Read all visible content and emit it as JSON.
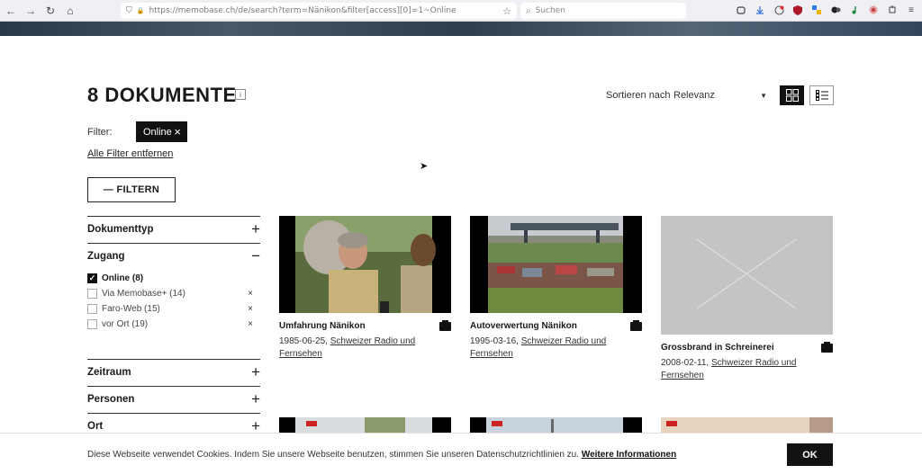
{
  "browser": {
    "url": "https://memobase.ch/de/search?term=Nänikon&filter[access][0]=1~Online",
    "search_placeholder": "Suchen"
  },
  "header": {
    "title": "8 DOKUMENTE",
    "info_icon": "i",
    "sort_label": "Sortieren nach",
    "sort_value": "Relevanz"
  },
  "filters": {
    "label": "Filter:",
    "active_chip": "Online",
    "remove_all": "Alle Filter entfernen",
    "toggle_button": "— FILTERN"
  },
  "sidebar": {
    "sections": [
      {
        "label": "Dokumenttyp",
        "sign": "+"
      },
      {
        "label": "Zugang",
        "sign": "−"
      },
      {
        "label": "Zeitraum",
        "sign": "+"
      },
      {
        "label": "Personen",
        "sign": "+"
      },
      {
        "label": "Ort",
        "sign": "+"
      }
    ],
    "access_options": [
      {
        "label": "Online (8)",
        "checked": true
      },
      {
        "label": "Via Memobase+ (14)",
        "checked": false
      },
      {
        "label": "Faro-Web (15)",
        "checked": false
      },
      {
        "label": "vor Ort (19)",
        "checked": false
      }
    ],
    "remove_glyph": "×",
    "check_glyph": "✓"
  },
  "results": [
    {
      "title": "Umfahrung Nänikon",
      "date": "1985-06-25,",
      "source": "Schweizer Radio und Fernsehen"
    },
    {
      "title": "Autoverwertung Nänikon",
      "date": "1995-03-16,",
      "source": "Schweizer Radio und Fernsehen"
    },
    {
      "title": "Grossbrand in Schreinerei",
      "date": "2008-02-11,",
      "source": "Schweizer Radio und Fernsehen"
    }
  ],
  "cookie": {
    "text": "Diese Webseite verwendet Cookies. Indem Sie unsere Webseite benutzen, stimmen Sie unseren Datenschutzrichtlinien zu.",
    "link": "Weitere Informationen",
    "ok": "OK"
  },
  "icons": {
    "back": "←",
    "forward": "→",
    "reload": "↻",
    "home": "⌂",
    "shield": "⛉",
    "lock": "🔒",
    "star": "☆",
    "search": "⌕",
    "menu": "≡",
    "remove": "×"
  }
}
